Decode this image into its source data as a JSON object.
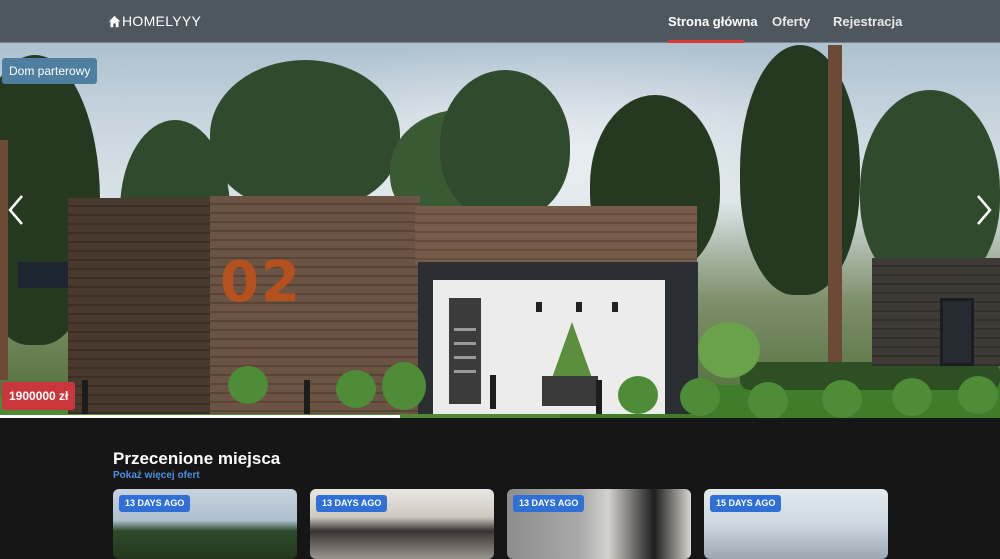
{
  "navbar": {
    "brand": "HOMELYYY",
    "links": [
      {
        "label": "Strona główna",
        "active": true
      },
      {
        "label": "Oferty",
        "active": false
      },
      {
        "label": "Rejestracja",
        "active": false
      }
    ]
  },
  "hero": {
    "type_badge": "Dom parterowy",
    "price_badge": "1900000 zł",
    "house_number": "02",
    "slide_progress": 0.4,
    "prev_icon": "chevron-left-icon",
    "next_icon": "chevron-right-icon"
  },
  "listings": {
    "title": "Przecenione miejsca",
    "more_link": "Pokaż więcej ofert",
    "cards": [
      {
        "date": "13 DAYS AGO"
      },
      {
        "date": "13 DAYS AGO"
      },
      {
        "date": "13 DAYS AGO"
      },
      {
        "date": "15 DAYS AGO"
      }
    ]
  },
  "colors": {
    "accent": "#e03636",
    "price_badge": "#c9363b",
    "type_badge": "#4f7fa0",
    "link": "#4a90e2",
    "date_badge": "#2f6fd6",
    "page_bg": "#161616"
  }
}
